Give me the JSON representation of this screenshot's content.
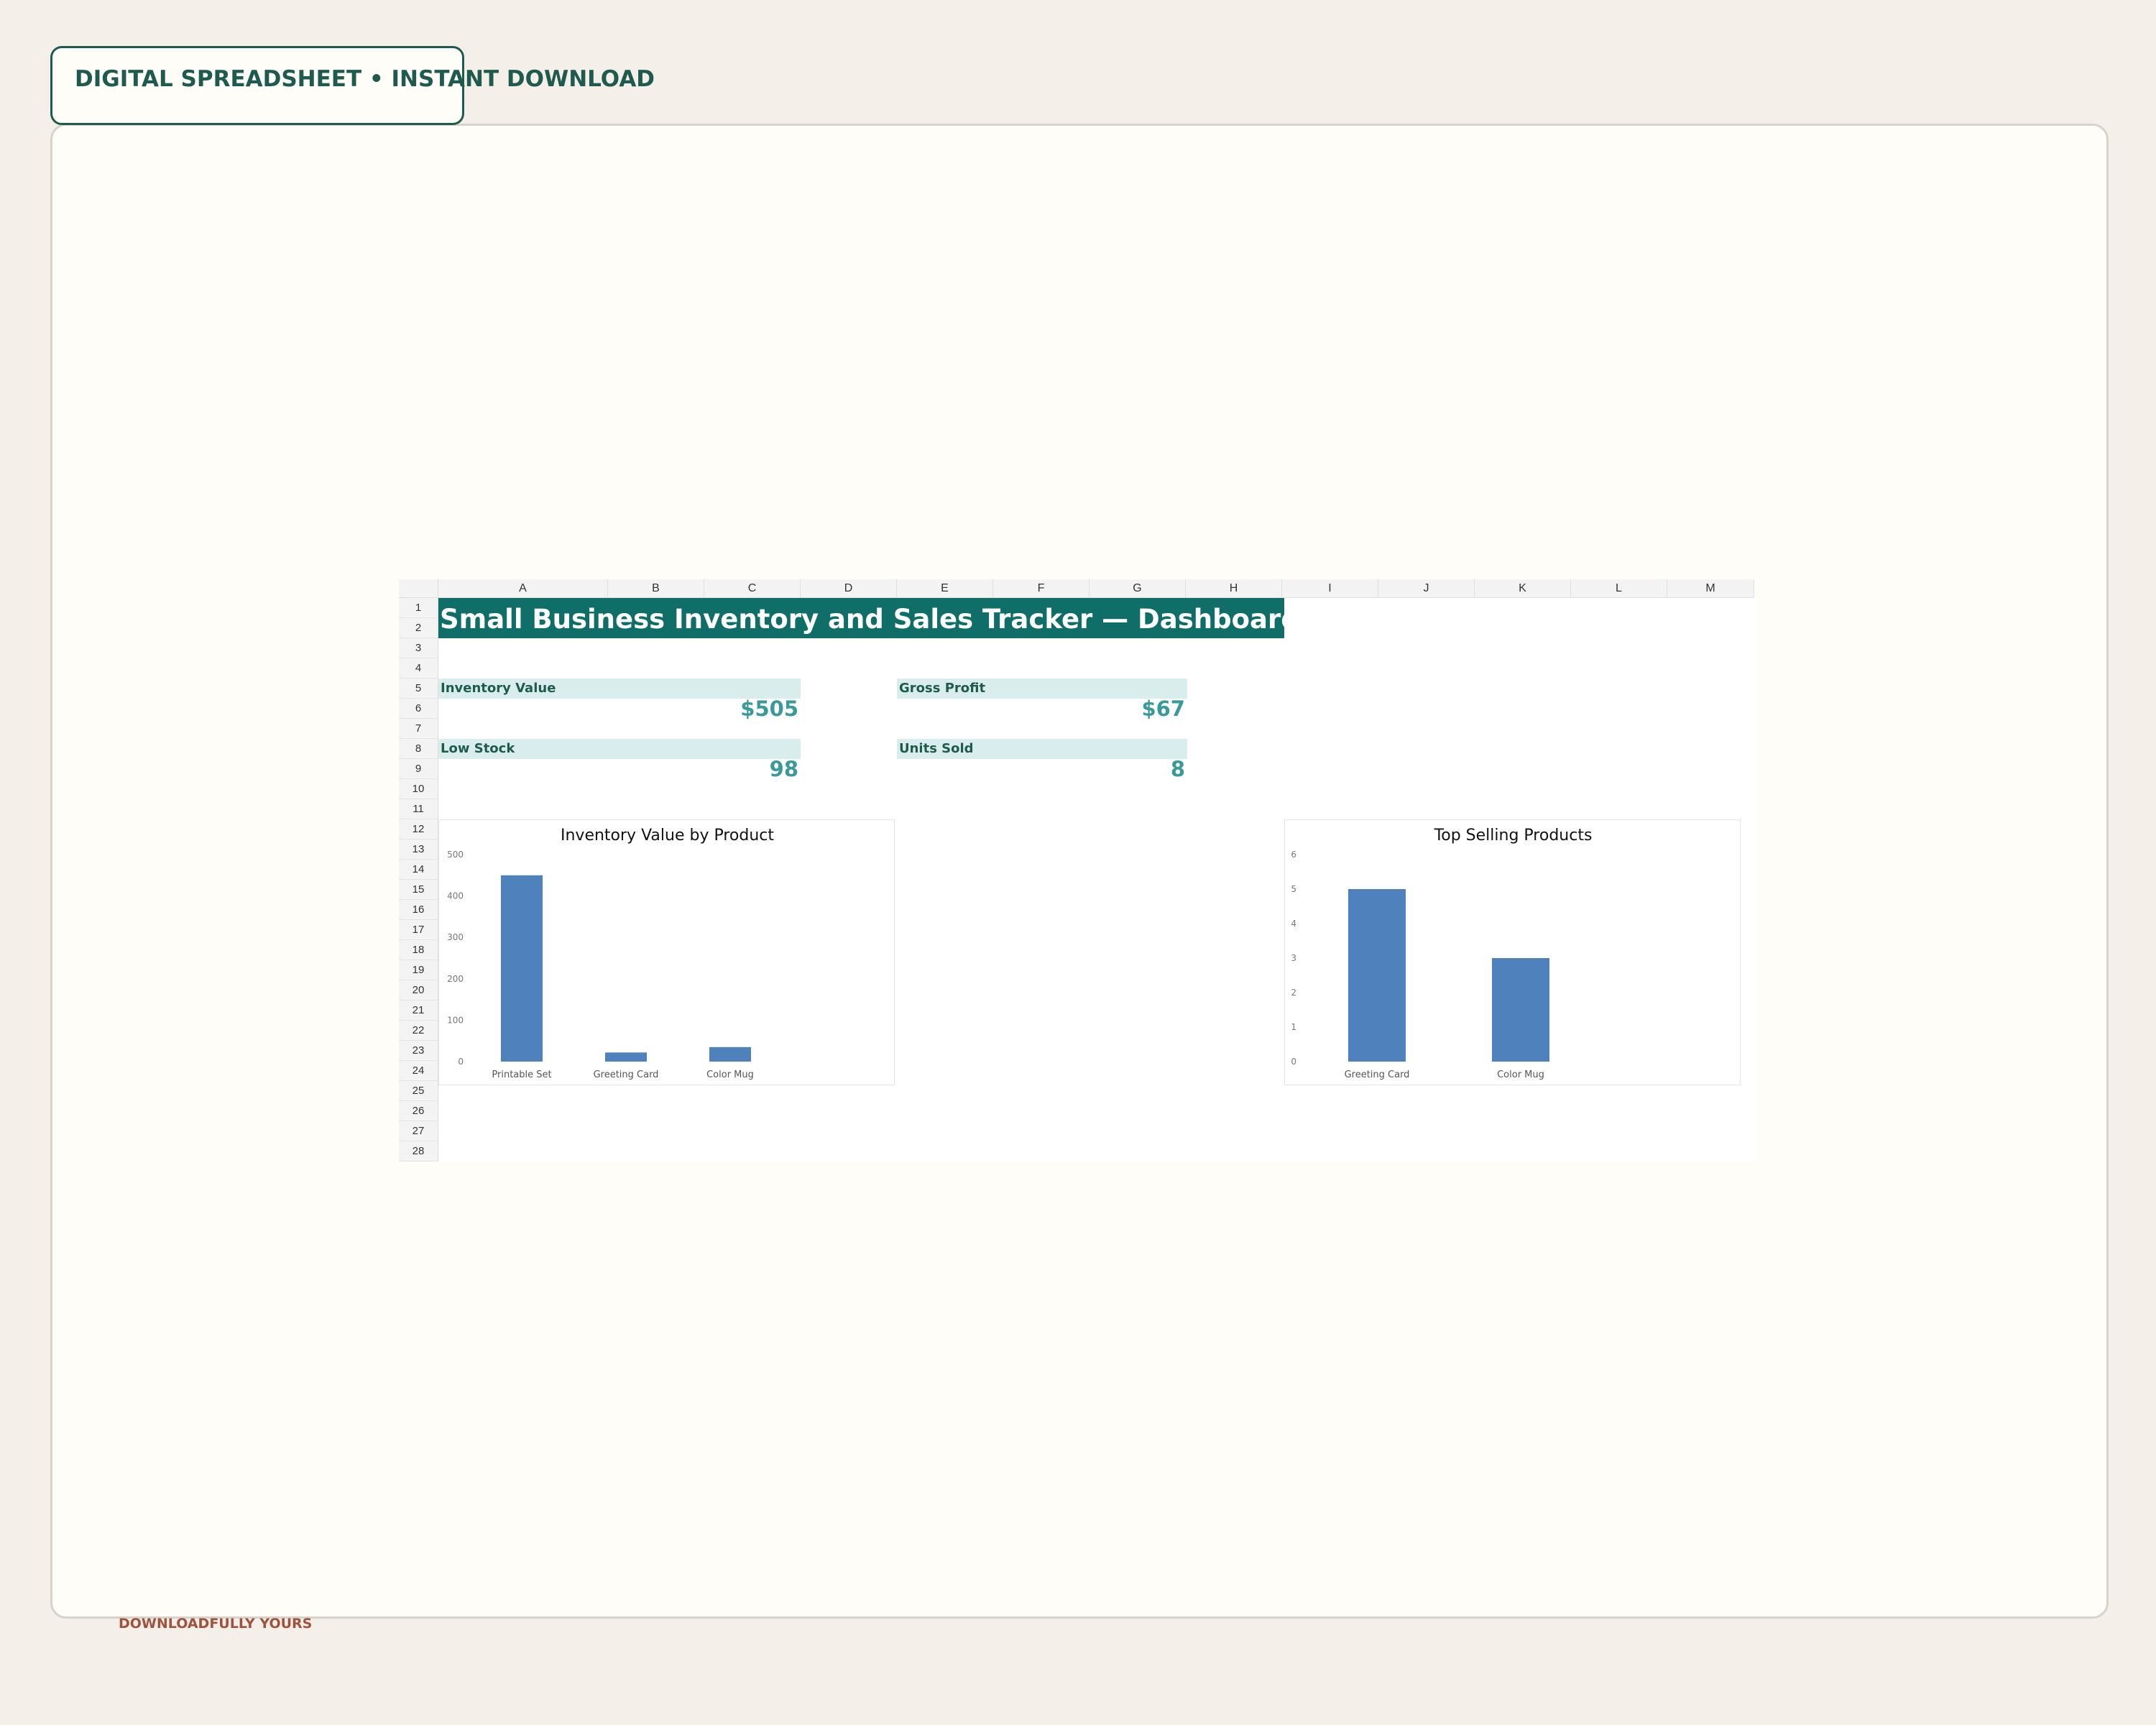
{
  "badge": {
    "text": "DIGITAL SPREADSHEET • INSTANT DOWNLOAD"
  },
  "footer": {
    "brand": "DOWNLOADFULLY YOURS"
  },
  "sheet": {
    "columns": [
      "A",
      "B",
      "C",
      "D",
      "E",
      "F",
      "G",
      "H",
      "I",
      "J",
      "K",
      "L",
      "M"
    ],
    "rows": [
      "1",
      "2",
      "3",
      "4",
      "5",
      "6",
      "7",
      "8",
      "9",
      "10",
      "11",
      "12",
      "13",
      "14",
      "15",
      "16",
      "17",
      "18",
      "19",
      "20",
      "21",
      "22",
      "23",
      "24",
      "25",
      "26",
      "27",
      "28"
    ],
    "title": "Small Business Inventory and Sales Tracker — Dashboard"
  },
  "kpis": {
    "inventory_value": {
      "label": "Inventory Value",
      "value": "$505"
    },
    "gross_profit": {
      "label": "Gross Profit",
      "value": "$67"
    },
    "low_stock": {
      "label": "Low Stock",
      "value": "98"
    },
    "units_sold": {
      "label": "Units Sold",
      "value": "8"
    }
  },
  "colors": {
    "bar": "#4f81bd",
    "teal": "#0f6e67",
    "kpi_value": "#3a9a9a"
  },
  "chart_data": [
    {
      "type": "bar",
      "title": "Inventory Value by Product",
      "categories": [
        "Printable Set",
        "Greeting Card",
        "Color Mug"
      ],
      "values": [
        450,
        22,
        35
      ],
      "ylim": [
        0,
        500
      ],
      "yticks": [
        "0",
        "100",
        "200",
        "300",
        "400",
        "500"
      ],
      "grid": false
    },
    {
      "type": "bar",
      "title": "Top Selling Products",
      "categories": [
        "Greeting Card",
        "Color Mug"
      ],
      "values": [
        5,
        3
      ],
      "ylim": [
        0,
        6
      ],
      "yticks": [
        "0",
        "1",
        "2",
        "3",
        "4",
        "5",
        "6"
      ],
      "grid": false
    }
  ]
}
